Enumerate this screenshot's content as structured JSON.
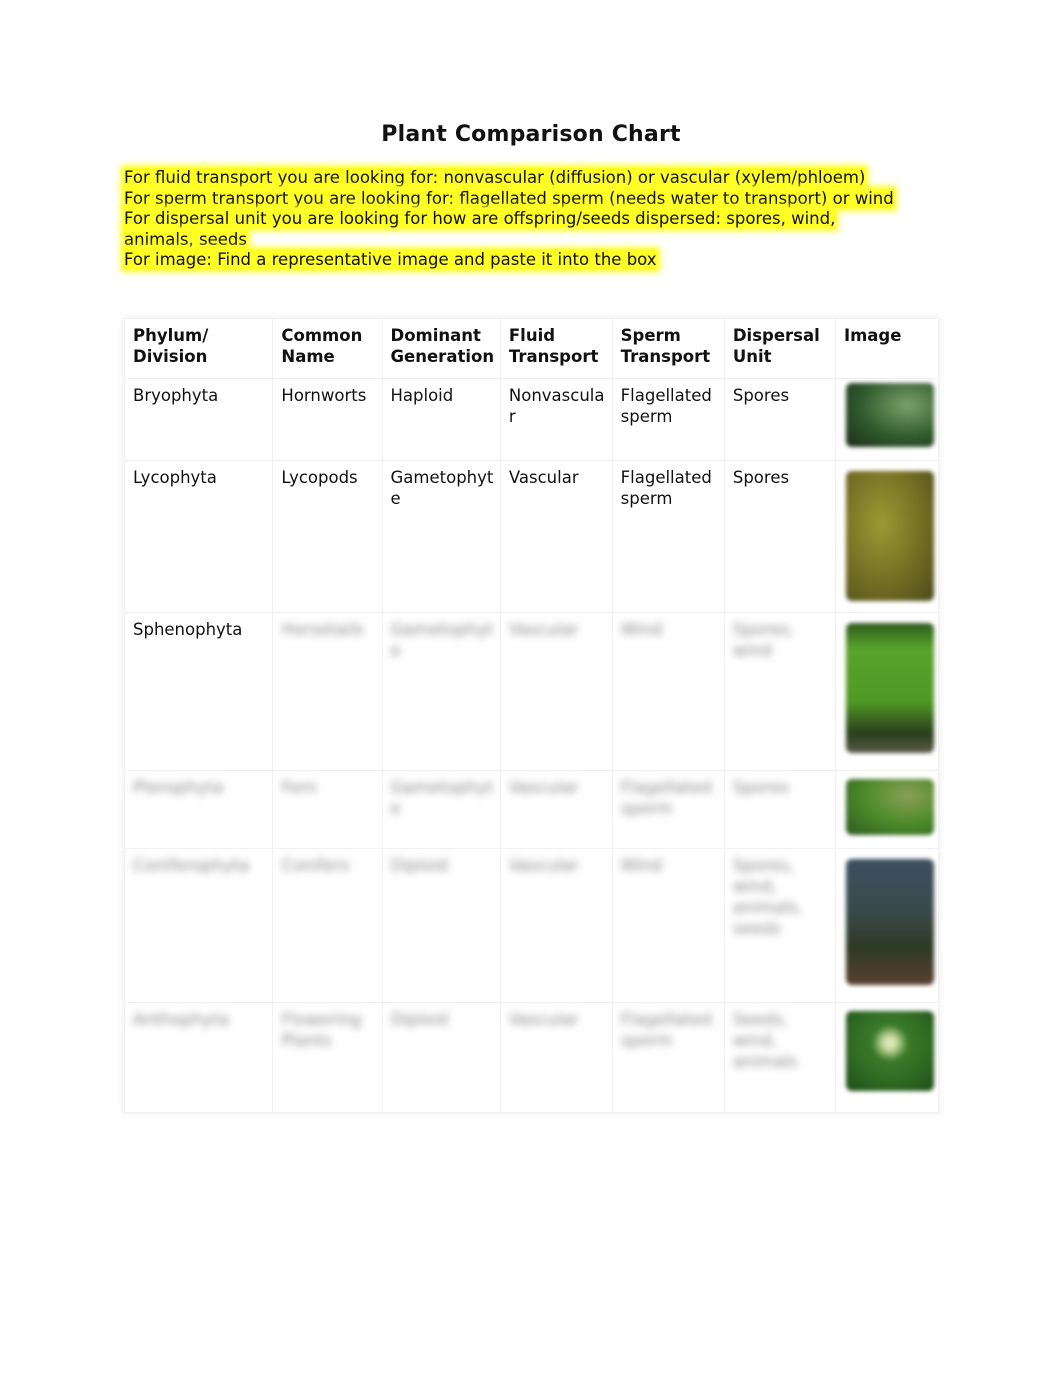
{
  "page": {
    "title": "Plant Comparison Chart",
    "instructions": [
      "For fluid transport you are looking for: nonvascular (diffusion) or vascular (xylem/phloem)",
      "For sperm transport you are looking for: flagellated sperm (needs water to transport) or wind",
      "For dispersal unit you are looking for how are offspring/seeds dispersed: spores, wind,",
      "animals, seeds",
      "For image: Find a representative image and paste it into the box"
    ],
    "highlight_color": "#ffff24"
  },
  "table": {
    "headers": [
      "Phylum/ Division",
      "Common Name",
      "Dominant Generation",
      "Fluid Transport",
      "Sperm Transport",
      "Dispersal Unit",
      "Image"
    ],
    "rows": [
      {
        "phylum": "Bryophyta",
        "common": "Hornworts",
        "generation": "Haploid",
        "fluid": "Nonvascular",
        "sperm": "Flagellated sperm",
        "dispersal": "Spores",
        "image": "hornwort-photo",
        "blurred": false
      },
      {
        "phylum": "Lycophyta",
        "common": "Lycopods",
        "generation": "Gametophyte",
        "fluid": "Vascular",
        "sperm": "Flagellated sperm",
        "dispersal": "Spores",
        "image": "lycopod-photo",
        "blurred": false
      },
      {
        "phylum": "Sphenophyta",
        "common": "Horsetails",
        "generation": "Gametophyte",
        "fluid": "Vascular",
        "sperm": "Wind",
        "dispersal": "Spores, wind",
        "image": "horsetail-photo",
        "blurred_cells": true
      },
      {
        "phylum": "Pterophyta",
        "common": "Fern",
        "generation": "Gametophyte",
        "fluid": "Vascular",
        "sperm": "Flagellated sperm",
        "dispersal": "Spores",
        "image": "fern-photo",
        "blurred": true
      },
      {
        "phylum": "Coniferophyta",
        "common": "Conifers",
        "generation": "Diploid",
        "fluid": "Vascular",
        "sperm": "Wind",
        "dispersal": "Spores, wind, animals, seeds",
        "image": "conifer-photo",
        "blurred": true
      },
      {
        "phylum": "Anthophyta",
        "common": "Flowering Plants",
        "generation": "Diploid",
        "fluid": "Vascular",
        "sperm": "Flagellated sperm",
        "dispersal": "Seeds, wind, animals",
        "image": "flower-photo",
        "blurred": true
      }
    ]
  }
}
